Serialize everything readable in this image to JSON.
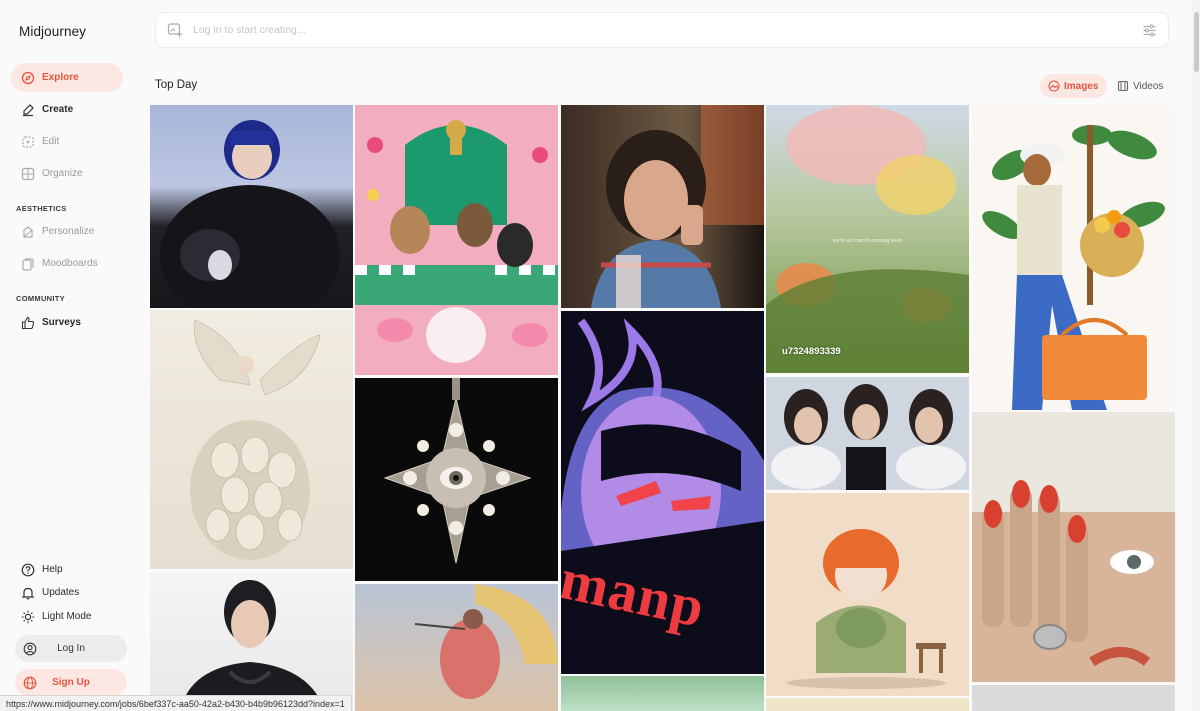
{
  "app": {
    "title": "Midjourney"
  },
  "sidebar": {
    "items": [
      {
        "label": "Explore",
        "icon": "compass-icon"
      },
      {
        "label": "Create",
        "icon": "brush-icon"
      },
      {
        "label": "Edit",
        "icon": "edit-icon"
      },
      {
        "label": "Organize",
        "icon": "grid-icon"
      }
    ],
    "aesthetics_label": "AESTHETICS",
    "aesthetics_items": [
      {
        "label": "Personalize",
        "icon": "palette-icon"
      },
      {
        "label": "Moodboards",
        "icon": "moodboard-icon"
      }
    ],
    "community_label": "COMMUNITY",
    "community_items": [
      {
        "label": "Surveys",
        "icon": "thumbs-up-icon"
      }
    ],
    "bottom_items": [
      {
        "label": "Help",
        "icon": "help-icon"
      },
      {
        "label": "Updates",
        "icon": "bell-icon"
      },
      {
        "label": "Light Mode",
        "icon": "sun-icon"
      }
    ],
    "login_label": "Log In",
    "signup_label": "Sign Up"
  },
  "search": {
    "placeholder": "Log in to start creating..."
  },
  "main": {
    "title": "Top Day",
    "toggle": {
      "images": "Images",
      "videos": "Videos"
    }
  },
  "tiles": {
    "t4_label": "u7324893339",
    "t4_watermark": "socre art merch coming soon",
    "t8_text": "manp"
  },
  "status_url": "https://www.midjourney.com/jobs/6bef337c-aa50-42a2-b430-b4b9b96123dd?index=1",
  "colors": {
    "accent": "#e6553e",
    "accent_bg": "#fde7e3"
  }
}
